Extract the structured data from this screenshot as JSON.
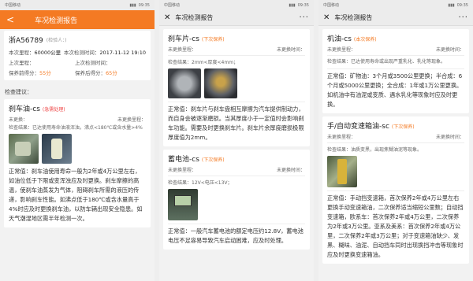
{
  "status": {
    "carrier": "中国移动",
    "time": "09:35",
    "battery": "▮▮▮"
  },
  "nav": {
    "title": "车况检测报告",
    "close": "✕",
    "more": "···"
  },
  "phone1": {
    "orange_title": "车况检测报告",
    "back": "<",
    "plate": "浙A56789",
    "inspector": "(检验人：)",
    "mileage_label": "本次里程：",
    "mileage_value": "60000公里",
    "check_time_label": "本次检测时间：",
    "check_time_value": "2017-11-12 19:10",
    "last_mileage_label": "上次里程：",
    "last_time_label": "上次检测时间：",
    "score_before_label": "保养前得分：",
    "score_before_value": "55分",
    "score_after_label": "保养后得分：",
    "score_after_value": "65分",
    "advice_label": "检查建议：",
    "item_title": "刹车油-cs",
    "item_tag": "(急需处理)",
    "not_replaced": "未更换：",
    "not_replaced_right": "未更换里程：",
    "result": "检查结果：已达使用寿命油液浑浊，沸点<180℃或含水量>4%",
    "para": "正常值：刹车油使用寿命一般为2年或4万公里左右，如油位低于下限或变浑浊应及时更换。刹车摩擦的高温，使刹车油蒸发为气体，阻碍刹车所需的液压的传递，影响刹车性能。如沸点低于180℃或含水量高于4%时应及时更换刹车油，以防车辆出现安全隐患。如天气潮湿地区需半年检测一次。"
  },
  "phone2": {
    "item1_title": "刹车片-cs",
    "item1_tag": "(下次保养)",
    "item1_not_replaced": "未更换里程：",
    "item1_replace": "未更换时间：",
    "item1_result": "检查结果：2mm<厚度<4mm；",
    "item1_para": "正常值：刹车片与刹车盘相互摩擦为汽车提供制动力，而自身会被逐渐磨损。当其厚度小于一定值时会影响刹车功能。需要及时更换刹车片。刹车片余厚度磨损极限厚度值为2mm。",
    "item2_title": "蓄电池-cs",
    "item2_tag": "(下次保养)",
    "item2_not_replaced": "未更换里程：",
    "item2_replace": "未更换时间：",
    "item2_result": "检查结果：12V<电压<13V；",
    "item2_para": "正常值：一般汽车蓄电池的额定电压约12.8V，蓄电池电压不足容易导致汽车启动困难，应及时处理。"
  },
  "phone3": {
    "item1_title": "机油-cs",
    "item1_tag": "(本次保养)",
    "item1_not_replaced": "未更换里程：",
    "item1_replace": "未更换时间：",
    "item1_result": "检查结果：已达使用寿命或出现严重乳化、乳化等现象。",
    "item1_para": "正常值：矿物油：3个月或3500公里更换；半合成：6个月或5000公里更换；全合成：1年或1万公里更换。如机油中有油泥或变质、遇水乳化等现象时应及时更换。",
    "item2_title": "手/自动变速箱油-sc",
    "item2_tag": "(下次保养)",
    "item2_not_replaced": "未更换里程：",
    "item2_replace": "未更换时间：",
    "item2_result": "检查结果：油质变黑，出现焦糊油泥等现象。",
    "item2_para": "正常值：手动挡变速箱，首次保养2年或4万公里左右更换手动变速箱油，二次保养适当缩短公里数；自动挡变速箱，欧系车：首次保养2年或4万公里，二次保养为2年或3万公里。亚系及美系：首次保养2年或4万公里，二次保养2年或3万公里；对于变速箱油缺少、发黑、糊味、油泥、自动挡车同时出现换挡冲击等现象时应及时更换变速箱油。"
  }
}
